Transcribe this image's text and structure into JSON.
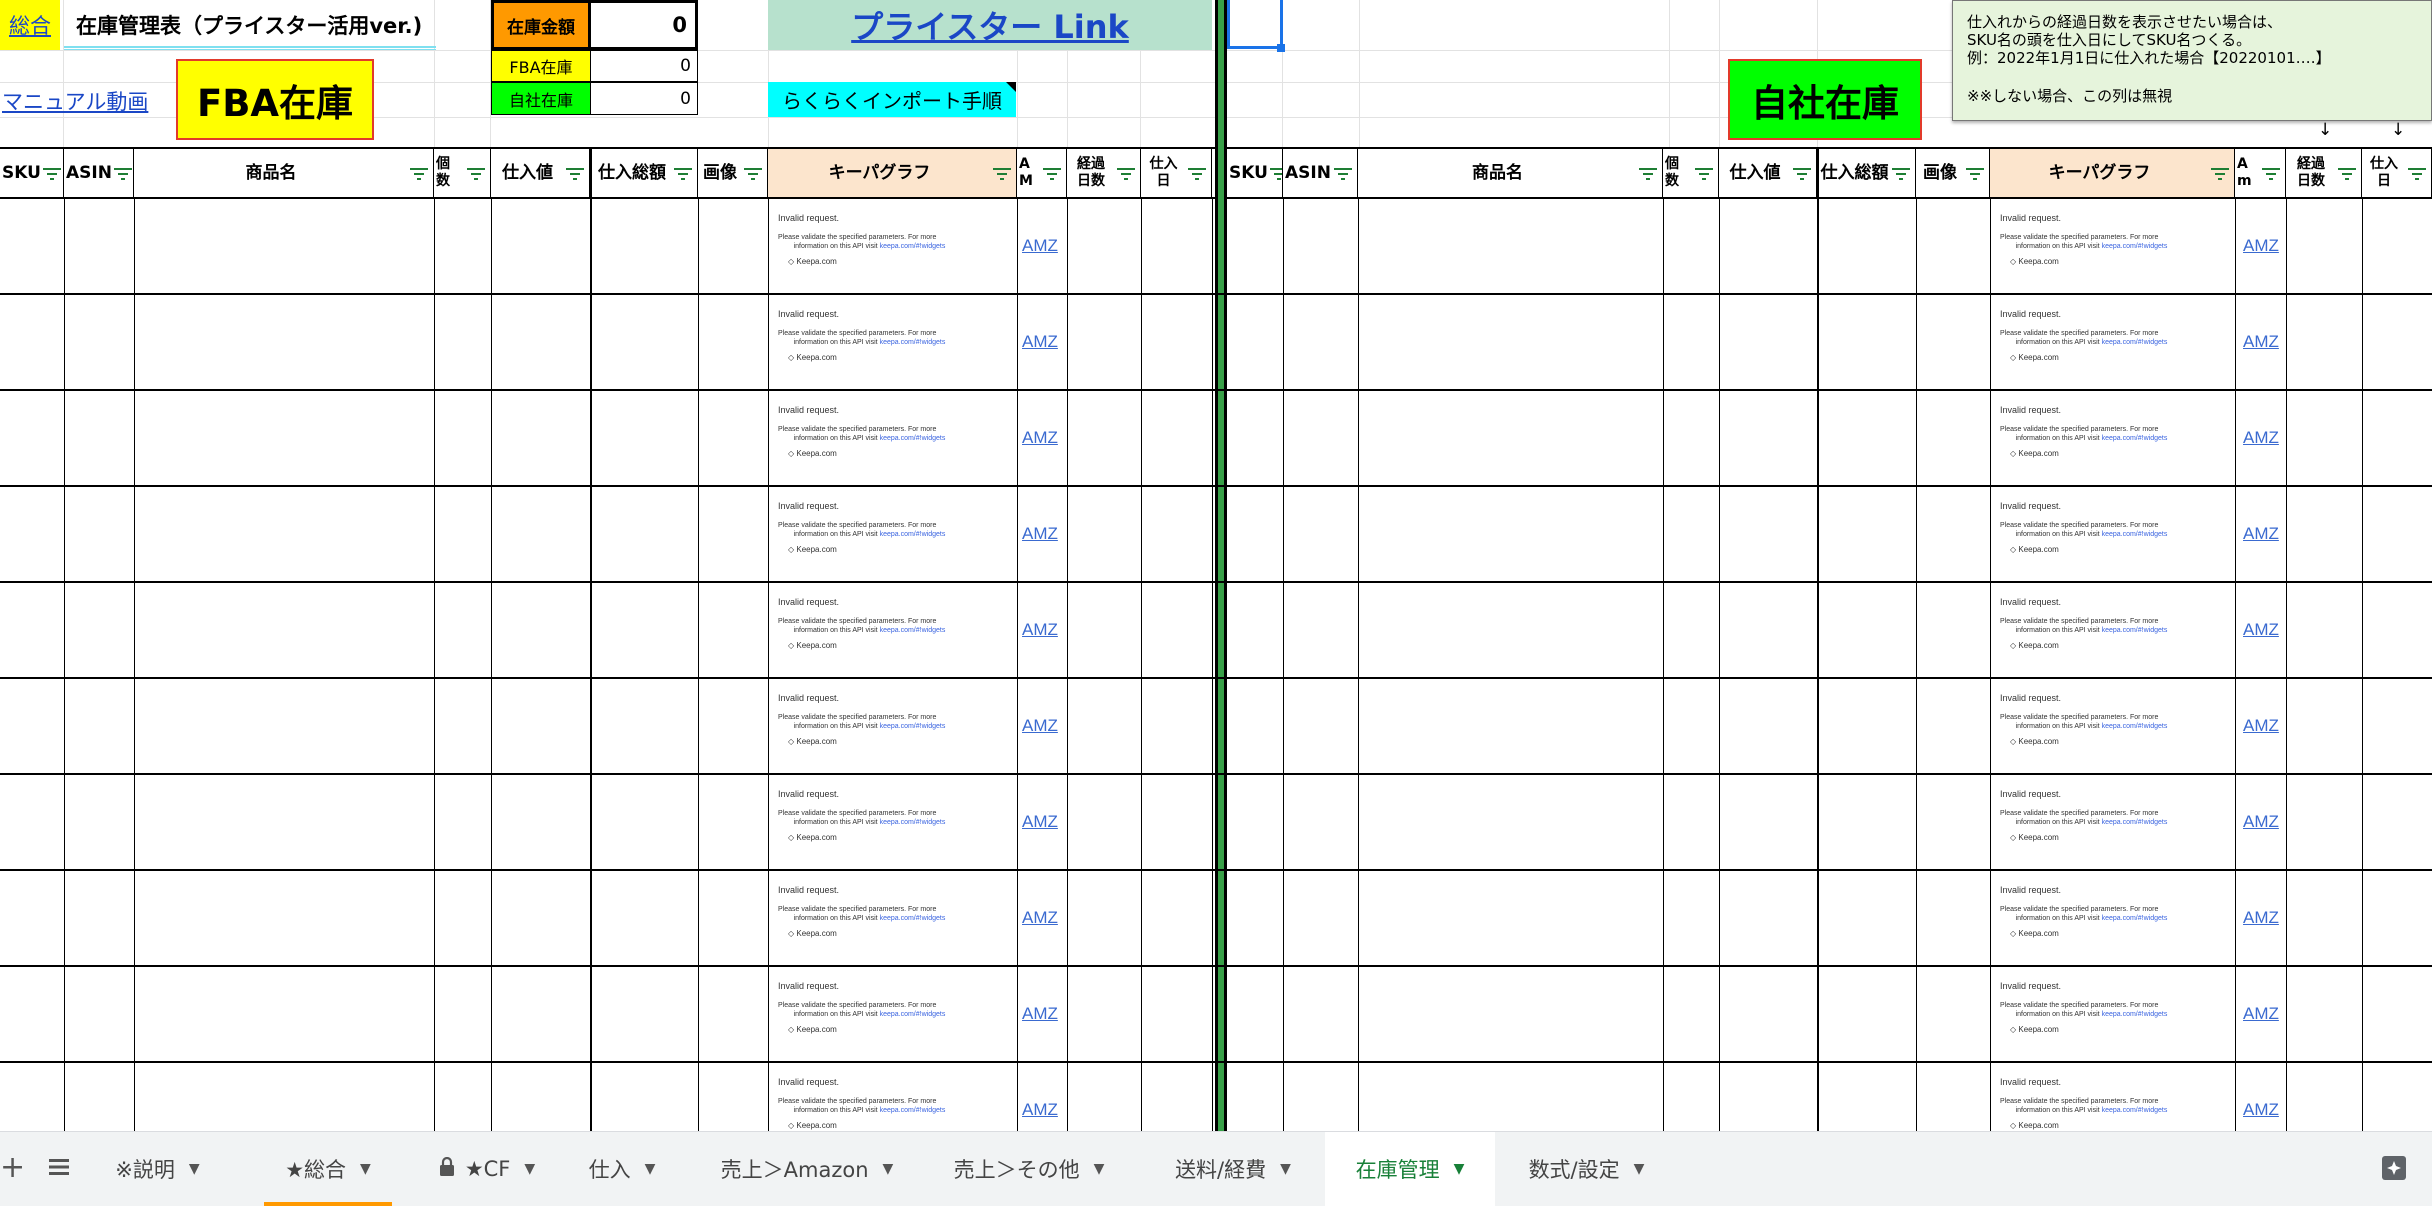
{
  "top": {
    "soukai_link": "総合",
    "sheet_title": "在庫管理表（プライスター活用ver.)",
    "manual_link": "マニュアル動画",
    "fba_big_label": "FBA在庫",
    "stock_amount_label": "在庫金額",
    "stock_amount_value": "0",
    "fba_stock_label": "FBA在庫",
    "fba_stock_value": "0",
    "own_stock_label": "自社在庫",
    "own_stock_value": "0",
    "pricester_link": "プライスター Link",
    "import_button": "らくらくインポート手順",
    "own_big_label": "自社在庫",
    "note_line1": "仕入れからの経過日数を表示させたい場合は、",
    "note_line2": "SKU名の頭を仕入日にしてSKU名つくる。",
    "note_line3": "例：2022年1月1日に仕入れた場合【20220101‥‥】",
    "note_line4": "※※しない場合、この列は無視",
    "arrow1": "↓",
    "arrow2": "↓"
  },
  "left_headers": [
    "SKU",
    "ASIN",
    "商品名",
    "個\n数",
    "仕入値",
    "仕入総額",
    "画像",
    "キーパグラフ",
    "A\nM",
    "経過\n日数",
    "仕入\n日"
  ],
  "right_headers": [
    "SKU",
    "ASIN",
    "商品名",
    "個\n数",
    "仕入値",
    "仕入総額",
    "画像",
    "キーパグラフ",
    "A\nm",
    "経過\n日数",
    "仕入\n日"
  ],
  "keepa": {
    "title": "Invalid request.",
    "line1": "Please validate the specified parameters. For more",
    "line2": "information on this API visit",
    "link": "keepa.com/#!widgets",
    "brand": "Keepa.com"
  },
  "amz_label": "AMZ",
  "tabs": [
    {
      "label": "※説明",
      "active": false
    },
    {
      "label": "★総合",
      "active": false
    },
    {
      "label": "★CF",
      "active": false
    },
    {
      "label": "仕入",
      "active": false
    },
    {
      "label": "売上＞Amazon",
      "active": false
    },
    {
      "label": "売上＞その他",
      "active": false
    },
    {
      "label": "送料/経費",
      "active": false
    },
    {
      "label": "在庫管理",
      "active": true
    },
    {
      "label": "数式/設定",
      "active": false
    }
  ],
  "colors": {
    "yellow": "#ffff00",
    "orange": "#ff9900",
    "light_green": "#b7e1cd",
    "bright_green": "#00ff00",
    "cyan": "#00ffff",
    "peach": "#fce5cd",
    "note_bg": "#e6f4dc",
    "active_tab": "#188038"
  }
}
